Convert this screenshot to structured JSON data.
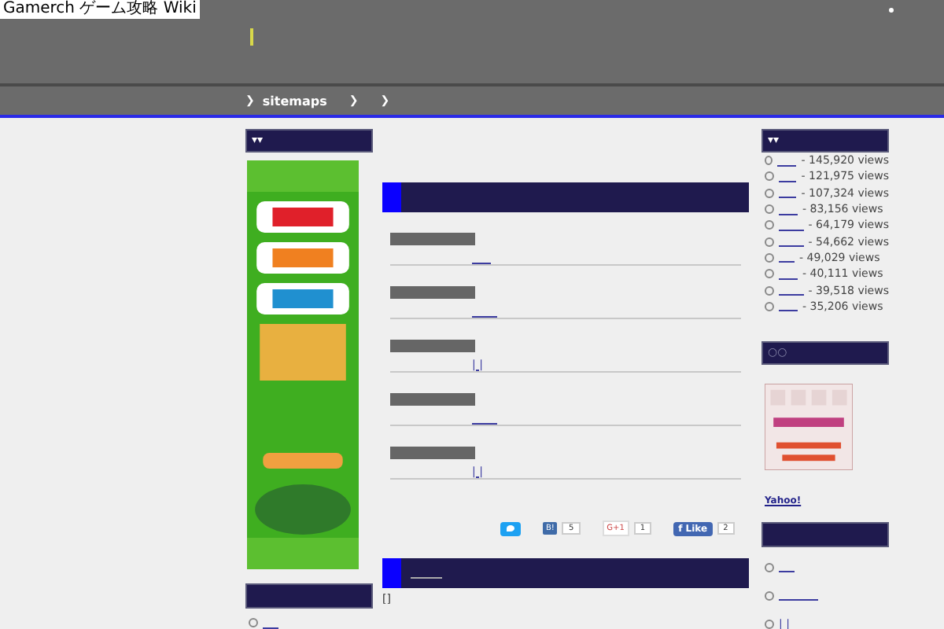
{
  "window": {
    "title": "Gamerch ゲーム攻略 Wiki"
  },
  "nav": {
    "items": [
      {
        "icon": "❯",
        "label": "sitemaps"
      },
      {
        "icon": "❯"
      },
      {
        "icon": "❯"
      }
    ]
  },
  "left": {
    "heading": "▾▾"
  },
  "main": {
    "entries": [
      {
        "kind": "link"
      },
      {
        "kind": "link"
      },
      {
        "kind": "text",
        "title": "| |"
      },
      {
        "kind": "link"
      },
      {
        "kind": "text",
        "title": "| |"
      }
    ],
    "share": [
      {
        "kind": "tweet"
      },
      {
        "kind": "hatena",
        "icon": "B!",
        "count": "5"
      },
      {
        "kind": "gplus",
        "icon": "G+1",
        "count": "1"
      },
      {
        "kind": "like",
        "icon": "f",
        "label": "Like",
        "count": "2"
      }
    ],
    "footer_text": "[]"
  },
  "right": {
    "heading": "▾▾",
    "popular": [
      {
        "views": "- 145,920 views"
      },
      {
        "views": "- 121,975 views"
      },
      {
        "views": "- 107,324 views"
      },
      {
        "views": "- 83,156 views"
      },
      {
        "views": "- 64,179 views"
      },
      {
        "views": "- 54,662 views"
      },
      {
        "views": "- 49,029 views"
      },
      {
        "views": "- 40,111 views"
      },
      {
        "views": "- 39,518 views"
      },
      {
        "views": "- 35,206 views"
      }
    ],
    "second_heading": "○○",
    "ad_link": "Yahoo!",
    "links": [
      {
        "kind": "link"
      },
      {
        "kind": "link"
      },
      {
        "kind": "text",
        "title": "| |"
      }
    ]
  }
}
